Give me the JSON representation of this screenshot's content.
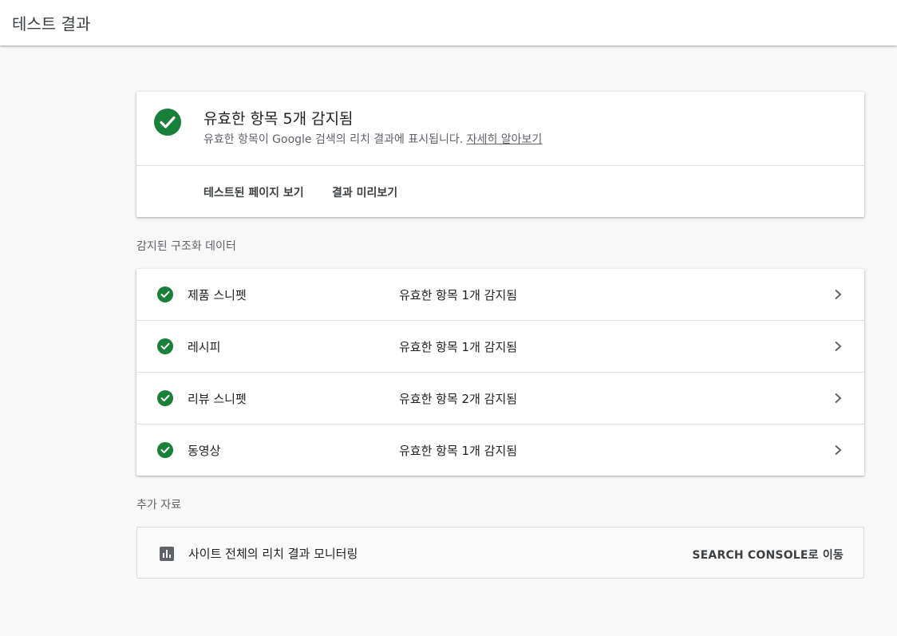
{
  "app_title": "테스트 결과",
  "summary": {
    "title": "유효한 항목 5개 감지됨",
    "subtitle": "유효한 항목이 Google 검색의 리치 결과에 표시됩니다. ",
    "learn_more": "자세히 알아보기",
    "actions": [
      "테스트된 페이지 보기",
      "결과 미리보기"
    ],
    "status_color": "#188038"
  },
  "detected_section": {
    "label": "감지된 구조화 데이터",
    "rows": [
      {
        "name": "제품 스니펫",
        "status": "유효한 항목 1개 감지됨"
      },
      {
        "name": "레시피",
        "status": "유효한 항목 1개 감지됨"
      },
      {
        "name": "리뷰 스니펫",
        "status": "유효한 항목 2개 감지됨"
      },
      {
        "name": "동영상",
        "status": "유효한 항목 1개 감지됨"
      }
    ]
  },
  "resources_section": {
    "label": "추가 자료",
    "item_label": "사이트 전체의 리치 결과 모니터링",
    "link": "SEARCH CONSOLE로 이동",
    "icon": "bar-chart-icon"
  }
}
